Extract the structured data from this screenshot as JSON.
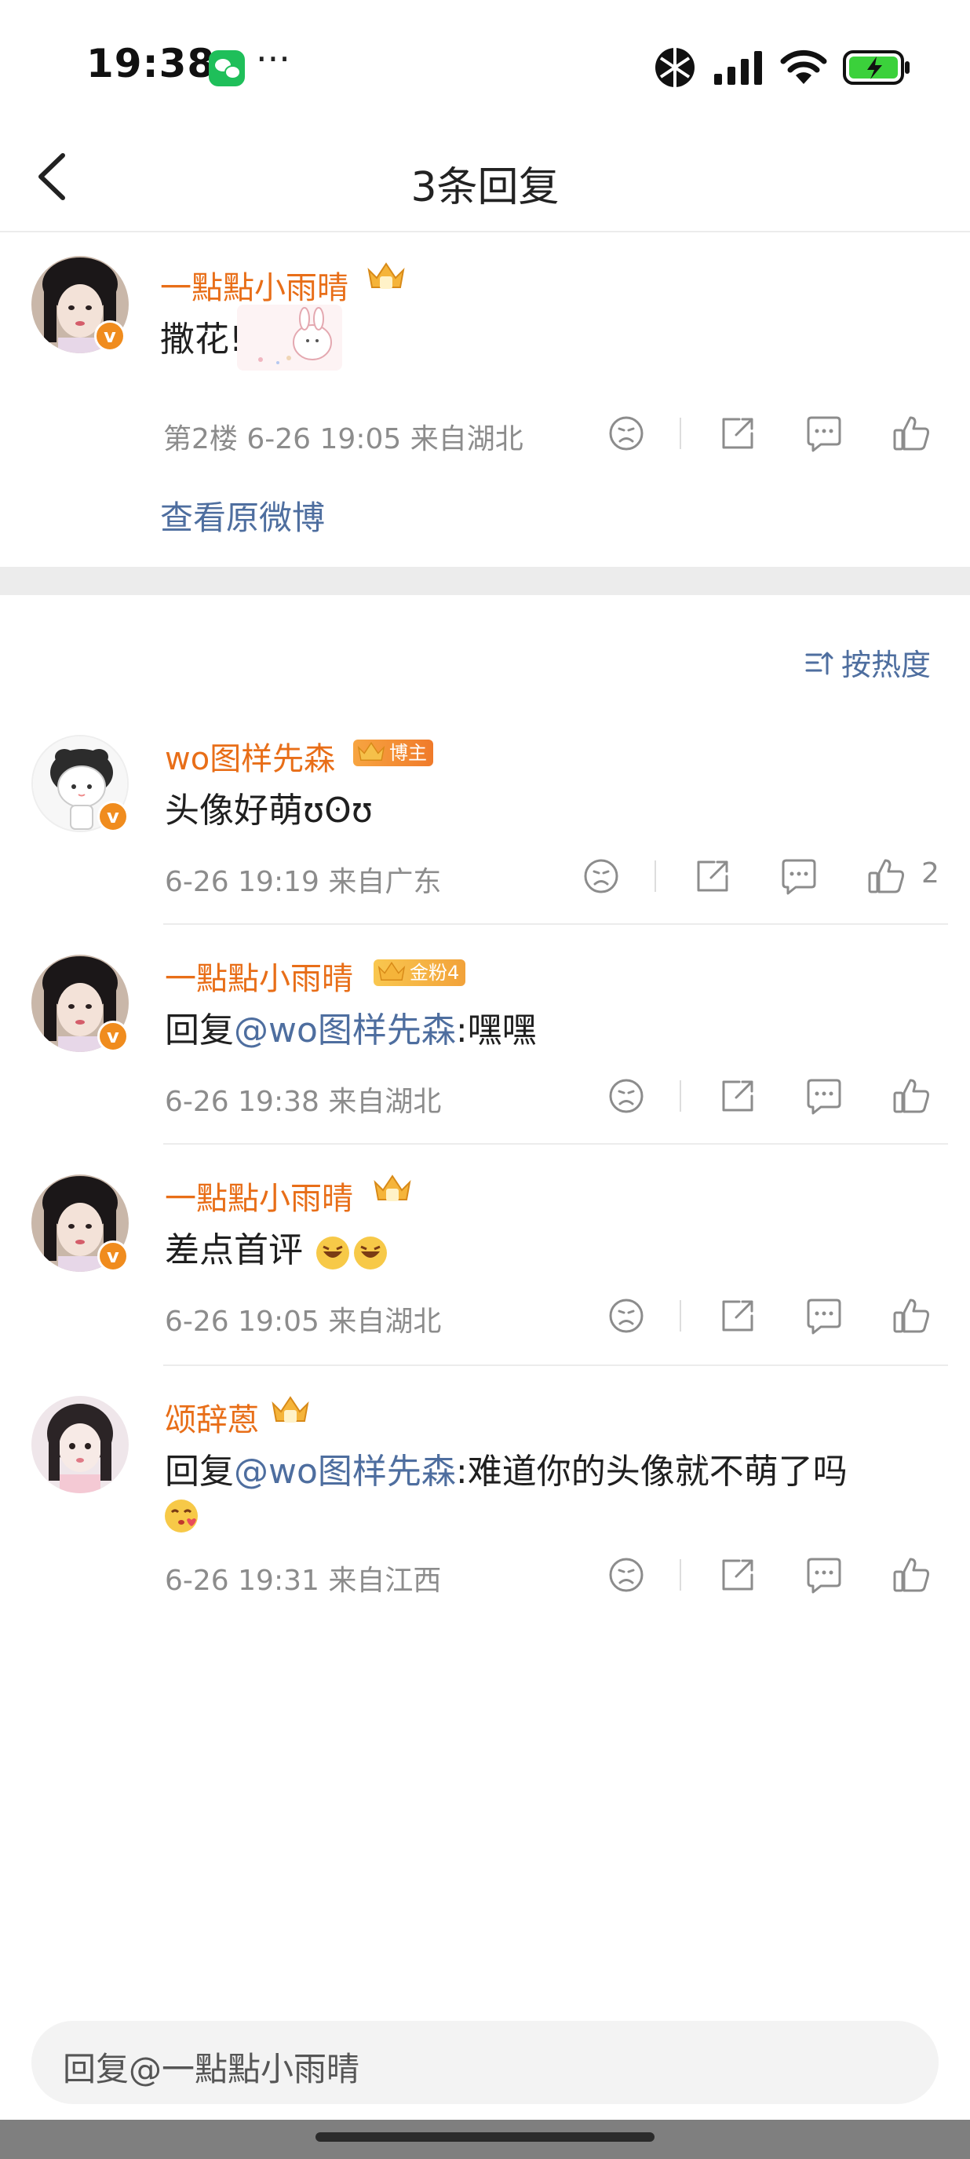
{
  "status_bar": {
    "time": "19:38",
    "dots": "···",
    "wechat_icon": "wechat-icon",
    "battery_color": "#3bd13b"
  },
  "nav": {
    "title": "3条回复",
    "back_icon": "chevron-left-icon"
  },
  "original_comment": {
    "name": "一點點小雨晴",
    "content": "撒花!",
    "floor": "第2楼",
    "time": "6-26 19:05",
    "location": "来自湖北",
    "view_original": "查看原微博"
  },
  "sort": {
    "label": "按热度",
    "icon": "sort-icon"
  },
  "replies": [
    {
      "name": "wo图样先森",
      "tag": "博主",
      "content": "头像好萌ʊʘʊ",
      "time": "6-26 19:19",
      "location": "来自广东",
      "likes": "2"
    },
    {
      "name": "一點點小雨晴",
      "tag": "金粉4",
      "prefix": "回复",
      "mention": "@wo图样先森",
      "content": ":嘿嘿",
      "time": "6-26 19:38",
      "location": "来自湖北"
    },
    {
      "name": "一點點小雨晴",
      "content": "差点首评",
      "time": "6-26 19:05",
      "location": "来自湖北"
    },
    {
      "name": "颂辞蒽",
      "prefix": "回复",
      "mention": "@wo图样先森",
      "content": ":难道你的头像就不萌了吗",
      "time": "6-26 19:31",
      "location": "来自江西"
    }
  ],
  "reply_input": {
    "placeholder": "回复@一點點小雨晴"
  },
  "colors": {
    "name": "#e86e18",
    "link": "#4e6e9f",
    "meta": "#8c8c8c",
    "verified": "#f08c1e"
  }
}
